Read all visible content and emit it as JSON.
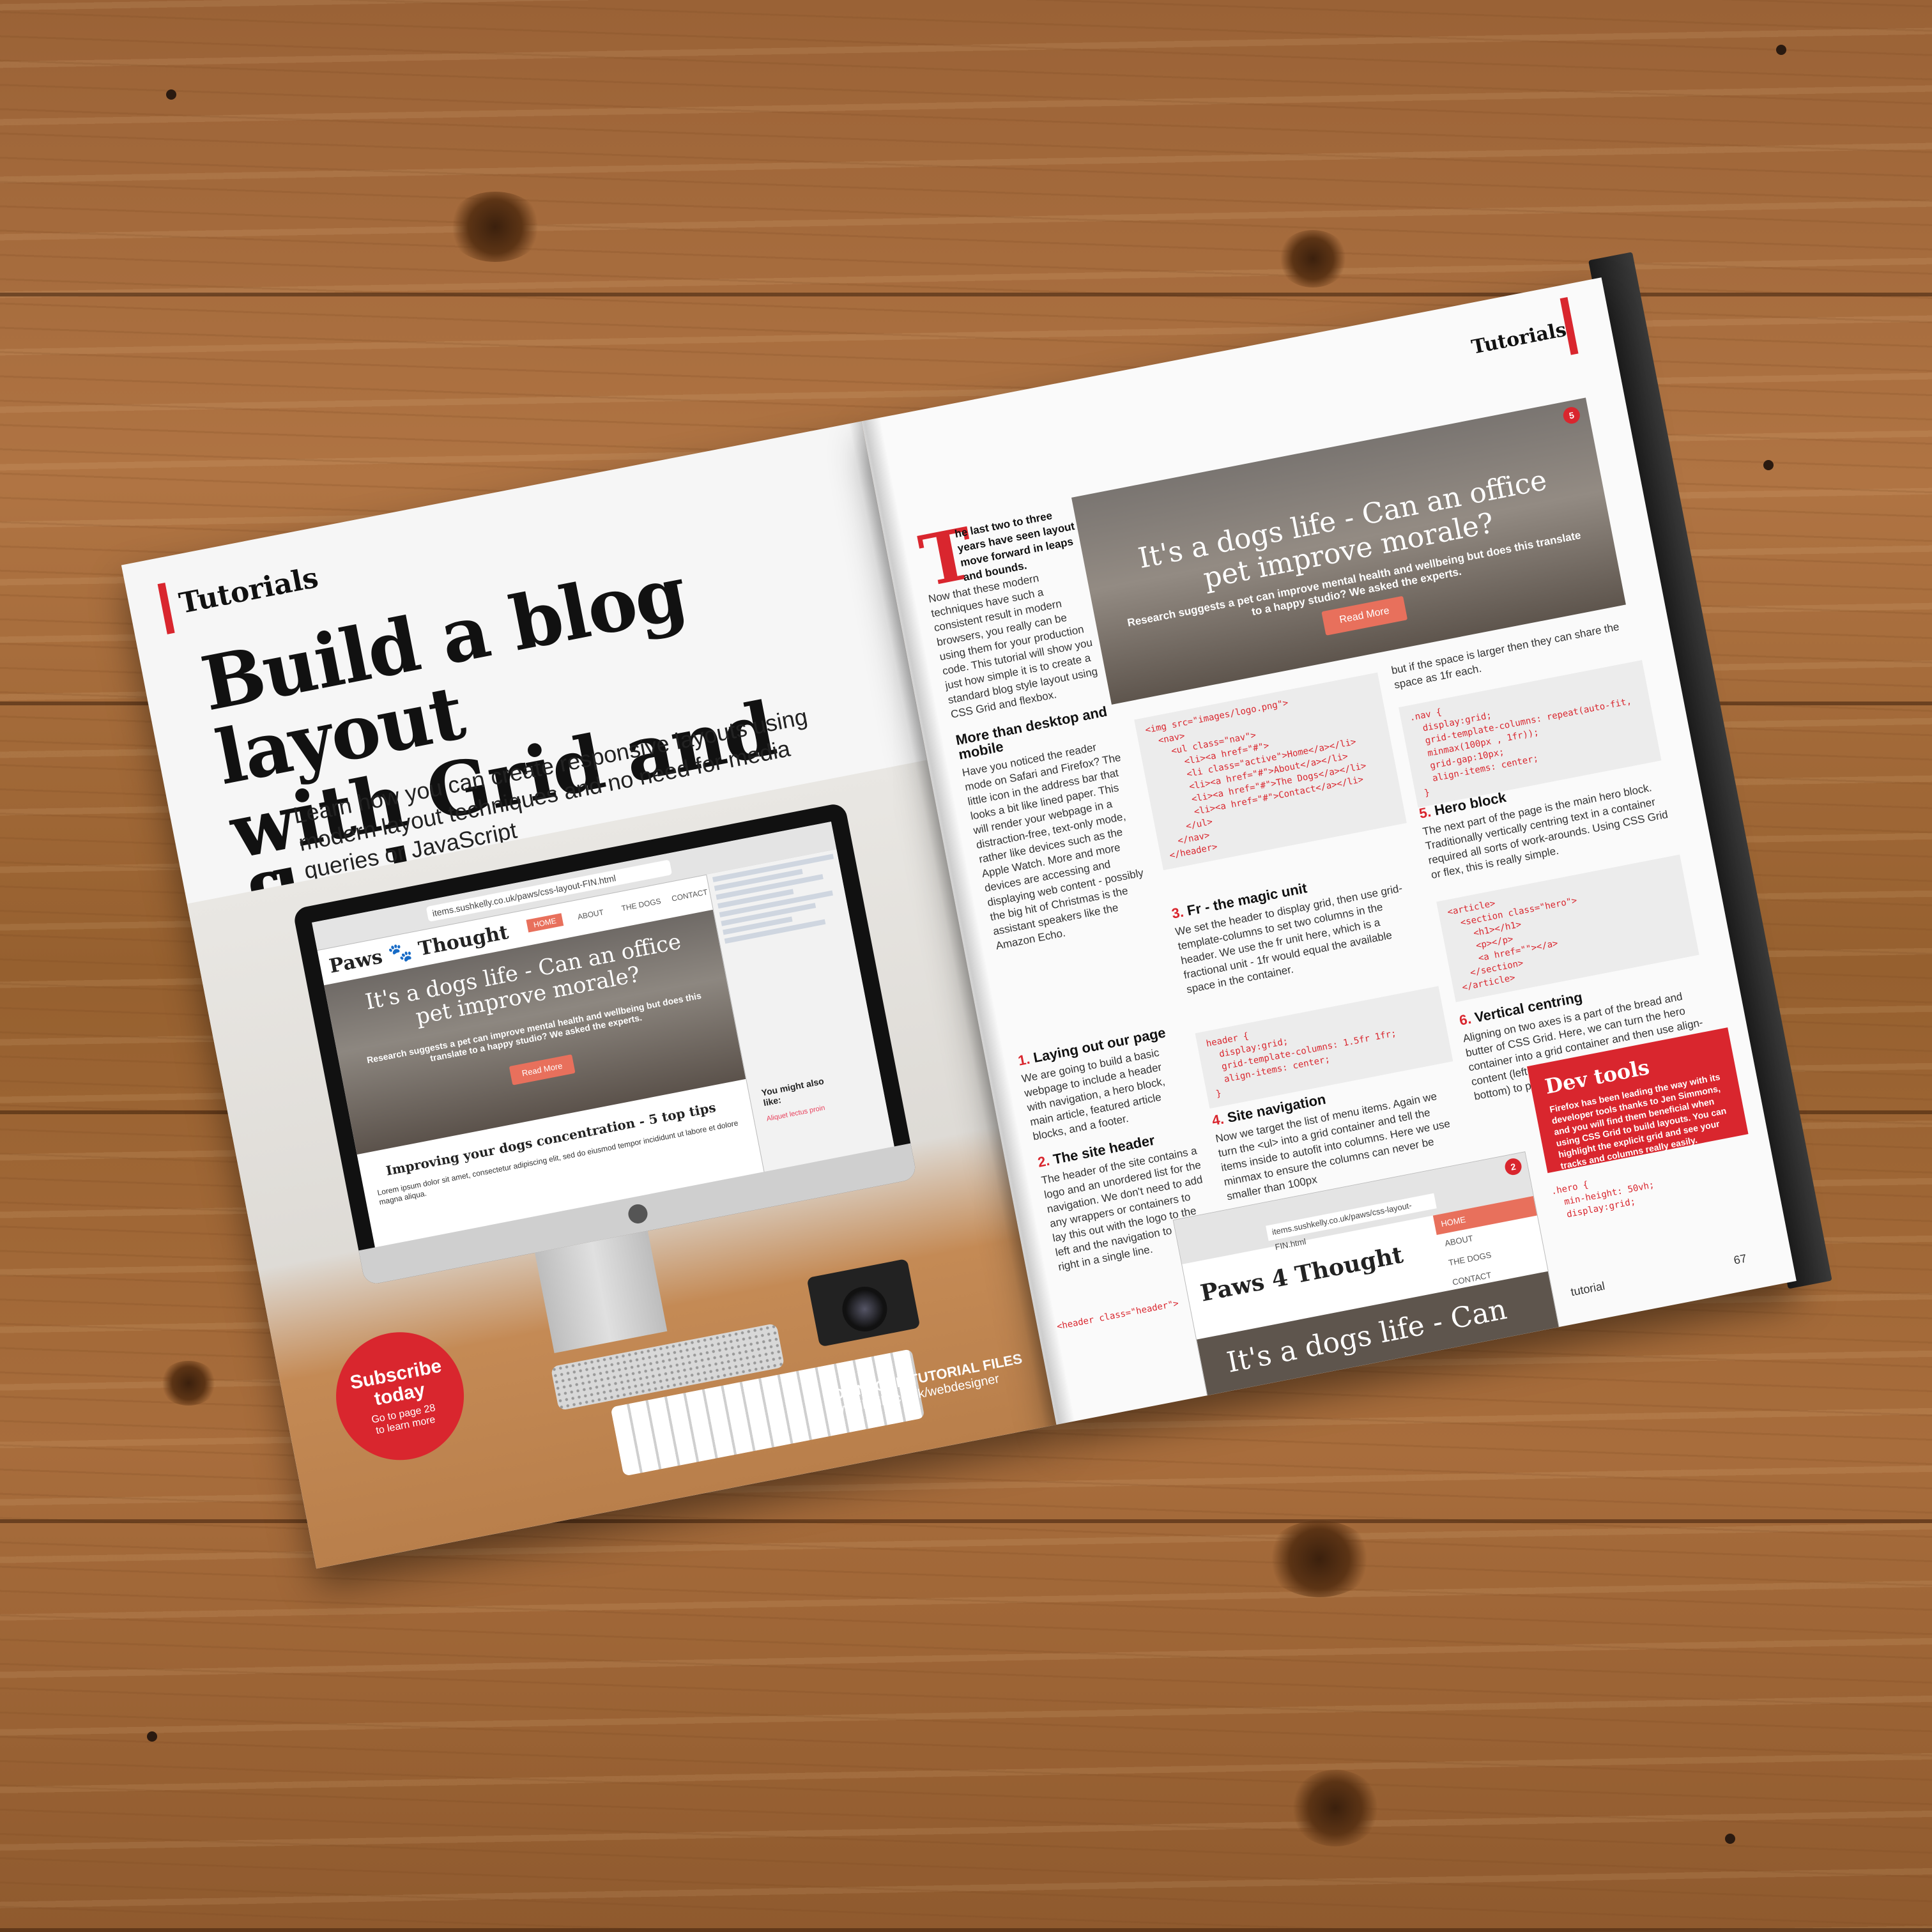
{
  "left_page": {
    "section": "Tutorials",
    "headline_line1": "Build a blog layout",
    "headline_line2": "with Grid and flexbox",
    "standfirst": "Learn how you can create responsive layouts using modern layout techniques and no need for media queries or JavaScript",
    "subscribe": {
      "line1": "Subscribe",
      "line2": "today",
      "line3": "Go to page 28",
      "line4": "to learn more"
    },
    "download": {
      "title": "DOWNLOAD TUTORIAL FILES",
      "url": "www.filesilo.co.uk/webdesigner"
    },
    "screen": {
      "url": "items.sushkelly.co.uk/paws/css-layout-FIN.html",
      "logo": "Paws 🐾 Thought",
      "nav": [
        "HOME",
        "ABOUT",
        "THE DOGS",
        "CONTACT"
      ],
      "hero_title": "It's a dogs life - Can an office pet improve morale?",
      "hero_sub": "Research suggests a pet can improve mental health and wellbeing but does this translate to a happy studio? We asked the experts.",
      "hero_button": "Read More",
      "article_title": "Improving your dogs concentration - 5 top tips",
      "article_body": "Lorem ipsum dolor sit amet, consectetur adipiscing elit, sed do eiusmod tempor incididunt ut labore et dolore magna aliqua.",
      "aside_title": "You might also like:",
      "aside_link": "Aliquet lectus proin"
    }
  },
  "right_page": {
    "section": "Tutorials",
    "intro_strong": "he last two to three years have seen layout move forward in leaps and bounds.",
    "intro_rest": "Now that these modern techniques have such a consistent result in modern browsers, you really can be using them for your production code. This tutorial will show you just how simple it is to create a standard blog style layout using CSS Grid and flexbox.",
    "drop_cap": "T",
    "h_more": "More than desktop and mobile",
    "p_more": "Have you noticed the reader mode on Safari and Firefox? The little icon in the address bar that looks a bit like lined paper. This will render your webpage in a distraction-free, text-only mode, rather like devices such as the Apple Watch. More and more devices are accessing and displaying web content - possibly the big hit of Christmas is the assistant speakers like the Amazon Echo.",
    "h1": "Laying out our page",
    "p1": "We are going to build a basic webpage to include a header with navigation, a hero block, main article, featured article blocks, and a footer.",
    "h2": "The site header",
    "p2": "The header of the site contains a logo and an unordered list for the navigation. We don't need to add any wrappers or containers to lay this out with the logo to the left and the navigation to the right in a single line.",
    "code_header": "<header class=\"header\">",
    "code_nav": "<img src=\"images/logo.png\">\n  <nav>\n    <ul class=\"nav\">\n      <li><a href=\"#\">\n      <li class=\"active\">Home</a></li>\n      <li><a href=\"#\">About</a></li>\n      <li><a href=\"#\">The Dogs</a></li>\n      <li><a href=\"#\">Contact</a></li>\n    </ul>\n  </nav>\n</header>",
    "h3": "Fr - the magic unit",
    "p3": "We set the header to display grid, then use grid-template-columns to set two columns in the header. We use the fr unit here, which is a fractional unit - 1fr would equal the available space in the container.",
    "code_fr": "header {\n  display:grid;\n  grid-template-columns: 1.5fr 1fr;\n  align-items: center;\n}",
    "h4": "Site navigation",
    "p4": "Now we target the list of menu items. Again we turn the <ul> into a grid container and tell the items inside to autofit into columns. Here we use minmax to ensure the columns can never be smaller than 100px",
    "p_share": "but if the space is larger then they can share the space as 1fr each.",
    "code_navgrid": ".nav {\n  display:grid;\n  grid-template-columns: repeat(auto-fit,\n  minmax(100px , 1fr));\n  grid-gap:10px;\n  align-items: center;\n}",
    "h5": "Hero block",
    "p5": "The next part of the page is the main hero block. Traditionally vertically centring text in a container required all sorts of work-arounds. Using CSS Grid or flex, this is really simple.",
    "code_hero": "<article>\n  <section class=\"hero\">\n    <h1></h1>\n    <p></p>\n    <a href=\"\"></a>\n  </section>\n</article>",
    "h6": "Vertical centring",
    "p6": "Aligning on two axes is a part of the bread and butter of CSS Grid. Here, we can turn the hero container into a grid container and then use align-content (left to right) and justify-content (top to bottom) to position in the centre.",
    "code_heroGrid": ".hero {\n  min-height: 50vh;\n  display:grid;",
    "dev_tools_title": "Dev tools",
    "dev_tools_body": "Firefox has been leading the way with its developer tools thanks to Jen Simmons, and you will find them beneficial when using CSS Grid to build layouts. You can highlight the explicit grid and see your tracks and columns really easily.",
    "hero_title": "It's a dogs life - Can an office pet improve morale?",
    "hero_sub": "Research suggests a pet can improve mental health and wellbeing but does this translate to a happy studio? We asked the experts.",
    "hero_button": "Read More",
    "shot": {
      "url": "items.sushkelly.co.uk/paws/css-layout-FIN.html",
      "logo": "Paws 4 Thought",
      "nav": [
        "HOME",
        "ABOUT",
        "THE DOGS",
        "CONTACT"
      ],
      "strip": "It's a dogs life - Can"
    },
    "folio_label": "tutorial",
    "page_number": "67",
    "badge_top": "5",
    "badge_bottom": "2"
  }
}
